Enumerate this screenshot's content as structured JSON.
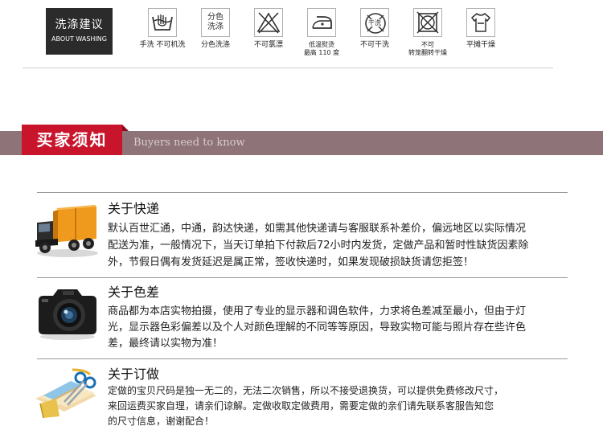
{
  "washing": {
    "title_cn": "洗涤建议",
    "title_en": "ABOUT WASHING",
    "items": [
      {
        "icon": "hand-wash-no-machine-icon",
        "label": "手洗 不可机洗"
      },
      {
        "icon": "separate-wash-icon",
        "box_text_1": "分色",
        "box_text_2": "洗涤",
        "label": "分色洗涤"
      },
      {
        "icon": "no-bleach-icon",
        "label": "不可氯漂"
      },
      {
        "icon": "low-iron-icon",
        "label_1": "低温熨烫",
        "label_2": "最高 110 度"
      },
      {
        "icon": "no-dry-clean-icon",
        "box_text_1": "干洗",
        "label": "不可干洗"
      },
      {
        "icon": "no-tumble-dry-icon",
        "label_1": "不可",
        "label_2": "转笼翻转干燥"
      },
      {
        "icon": "dry-flat-icon",
        "label": "平摊干燥"
      }
    ]
  },
  "buyers": {
    "title_cn": "买家须知",
    "title_en": "Buyers need to know"
  },
  "notices": [
    {
      "icon": "delivery-truck-icon",
      "title": "关于快递",
      "lines": [
        "默认百世汇通，中通，韵达快递，如需其他快递请与客服联系补差价，偏远地区以实际情况",
        "配送为准，一般情况下，当天订单拍下付款后72小时内发货，定做产品和暂时性缺货因素除",
        "外，节假日偶有发货延迟是属正常，签收快递时，如果发现破损缺货请您拒签！"
      ]
    },
    {
      "icon": "camera-icon",
      "title": "关于色差",
      "lines": [
        "商品都为本店实物拍摄，使用了专业的显示器和调色软件，力求将色差减至最小，但由于灯",
        "光，显示器色彩偏差以及个人对颜色理解的不同等等原因，导致实物可能与照片存在些许色",
        "差，最终请以实物为准！"
      ]
    },
    {
      "icon": "tailoring-tools-icon",
      "title": "关于订做",
      "lines": [
        "定做的宝贝尺码是独一无二的，无法二次销售，所以不接受退换货，可以提供免费修改尺寸，",
        "来回运费买家自理，请亲们谅解。定做收取定做费用，需要定做的亲们请先联系客服告知您",
        "的尺寸信息，谢谢配合！"
      ]
    }
  ]
}
